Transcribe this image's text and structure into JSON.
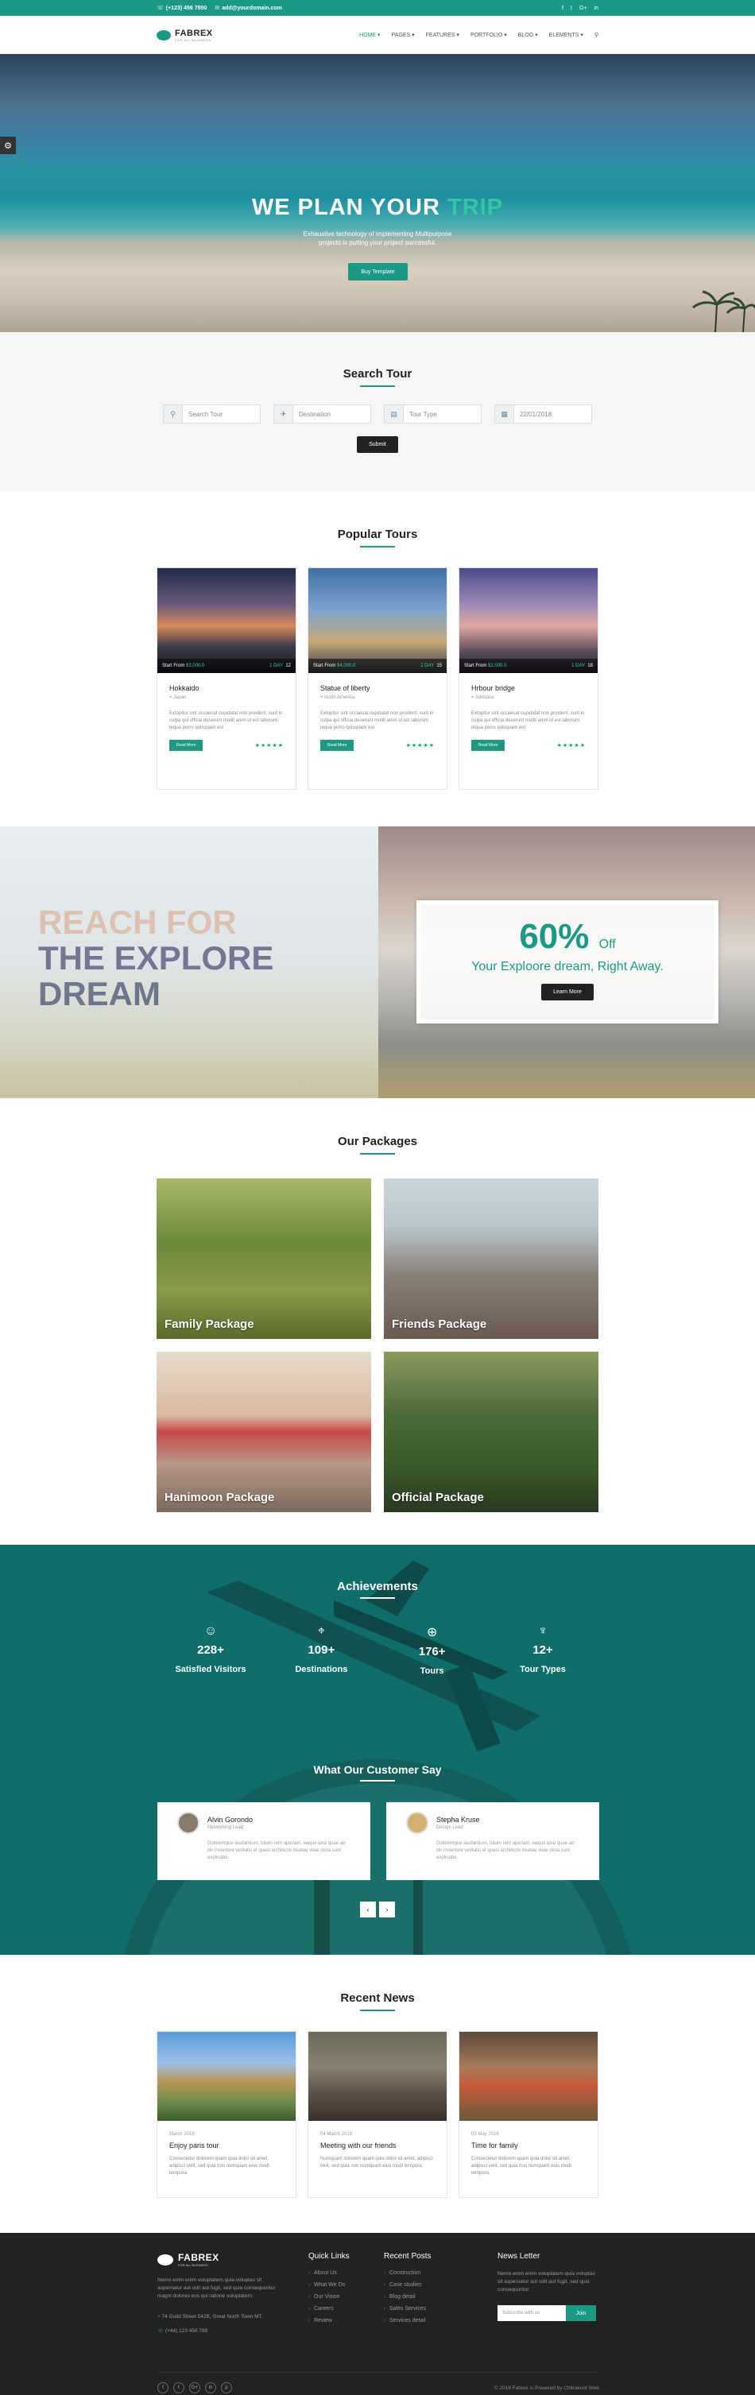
{
  "topbar": {
    "phone": "(+123) 456 7890",
    "email": "add@yourdomain.com",
    "social": [
      "f",
      "t",
      "G+",
      "in"
    ]
  },
  "header": {
    "logo_title": "FABREX",
    "logo_sub": "FOR ALL BUSINESS",
    "nav": [
      "HOME",
      "PAGES",
      "FEATURES",
      "PORTFOLIO",
      "BLOG",
      "ELEMENTS"
    ]
  },
  "hero": {
    "title_main": "WE PLAN YOUR",
    "title_accent": "TRIP",
    "subtitle_line1": "Exhaustive technology of implementing Multipurpose",
    "subtitle_line2": "projects is putting your project successful.",
    "button": "Buy Template"
  },
  "search": {
    "title": "Search Tour",
    "fields": [
      {
        "placeholder": "Search Tour",
        "icon": "search-icon"
      },
      {
        "placeholder": "Destination",
        "icon": "plane-icon"
      },
      {
        "placeholder": "Tour Type",
        "icon": "bus-icon"
      },
      {
        "value": "22/01/2018",
        "icon": "calendar-icon"
      }
    ],
    "submit": "Submit"
  },
  "tours": {
    "title": "Popular Tours",
    "items": [
      {
        "start": "Start From",
        "price": "$3,000.0",
        "days": "1 DAY",
        "count": "12",
        "name": "Hokkaido",
        "loc": "Japan",
        "desc": "Extopitur sint occaecat cupidatat non proident, sunt in culpa qui officia deserunt mollit anim id est laborum tequa porro quisquam est",
        "more": "Read More",
        "stars": "★★★★★"
      },
      {
        "start": "Start From",
        "price": "$4,000.0",
        "days": "2 DAY",
        "count": "15",
        "name": "Statue of liberty",
        "loc": "North America",
        "desc": "Extopitur sint occaecat cupidatat non proident, sunt in culpa qui officia deserunt mollit anim id est laborum tequa porro quisquam est",
        "more": "Read More",
        "stars": "★★★★★"
      },
      {
        "start": "Start From",
        "price": "$2,000.0",
        "days": "1 DAY",
        "count": "18",
        "name": "Hrbour bridge",
        "loc": "Australia",
        "desc": "Extopitur sint occaecat cupidatat non proident, sunt in culpa qui officia deserunt mollit anim id est laborum tequa porro quisquam est",
        "more": "Read More",
        "stars": "★★★★★"
      }
    ]
  },
  "banner": {
    "line1": "REACH FOR",
    "line2": "THE EXPLORE",
    "line3": "DREAM",
    "pct": "60%",
    "off": "Off",
    "sub": "Your Exploore dream, Right Away.",
    "button": "Learn More"
  },
  "packages": {
    "title": "Our Packages",
    "items": [
      "Family Package",
      "Friends Package",
      "Hanimoon Package",
      "Official Package"
    ]
  },
  "achievements": {
    "title": "Achievements",
    "stats": [
      {
        "n": "228+",
        "l": "Satisfied Visitors"
      },
      {
        "n": "109+",
        "l": "Destinations"
      },
      {
        "n": "176+",
        "l": "Tours"
      },
      {
        "n": "12+",
        "l": "Tour Types"
      }
    ]
  },
  "testimonials": {
    "title": "What Our Customer Say",
    "items": [
      {
        "name": "Alvin Gorondo",
        "role": "Networking Lead",
        "text": "Doloremque laudantium, totam rem aperiam, eaque ipsa quae ab illo inventore veritatis et quasi architecto beatae vitae dicta sunt explicabo."
      },
      {
        "name": "Stepha Kruse",
        "role": "Design Lead",
        "text": "Doloremque laudantium, totam rem aperiam, eaque ipsa quae ab illo inventore veritatis et quasi architecto beatae vitae dicta sunt explicabo."
      }
    ],
    "prev": "‹",
    "next": "›"
  },
  "news": {
    "title": "Recent News",
    "items": [
      {
        "date": "March 2018",
        "title": "Enjoy paris tour",
        "text": "Consectetur dolorem quam quia dolor sit amet, adipisci velit, sed quia non numquam eius modi tempora."
      },
      {
        "date": "04 March 2018",
        "title": "Meeting with our friends",
        "text": "Numquam dolorem quam quia dolor sit amet, adipisci velit, sed quia non numquam eius modi tempora."
      },
      {
        "date": "03 May 2018",
        "title": "Time for family",
        "text": "Consectetur dolorem quam quia dolor sit amet, adipisci velit, sed quia non numquam eius modi tempora."
      }
    ]
  },
  "footer": {
    "logo": "FABREX",
    "logo_sub": "FOR ALL BUSINESS",
    "about": "Nemo enim enim voluptatem quia voluptas sit aspernatur aut odit aut fugit, sed quia consequuntur magni dolores eos qui ratione voluptatem.",
    "address": "74 Guild Street 542B, Great North Town MT.",
    "phone": "(+44) 123 456 789",
    "quick_title": "Quick Links",
    "quick": [
      "About Us",
      "What We Do",
      "Our Vision",
      "Careers",
      "Review"
    ],
    "recent_title": "Recent Posts",
    "recent": [
      "Construction",
      "Case studies",
      "Blog detail",
      "Sales Services",
      "Services detail"
    ],
    "news_title": "News Letter",
    "news_text": "Nemo enim enim voluptatem quia voluptas sit aspernatur aut odit aut fugit, sed quia consequuntur.",
    "subscribe_placeholder": "Subscribe with us",
    "join": "Join",
    "copy": "© 2018 Fabrex is Powered by Chitrakoot Web",
    "social": [
      "f",
      "t",
      "G+",
      "in",
      "p"
    ]
  }
}
